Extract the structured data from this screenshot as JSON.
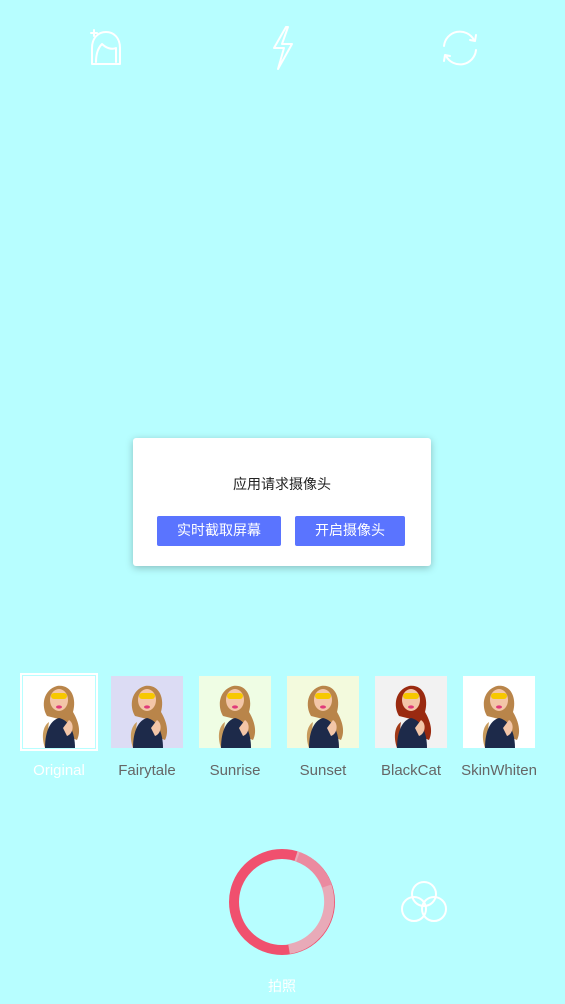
{
  "toolbar": {
    "beauty_icon": "beauty-face-icon",
    "flash_icon": "flash-icon",
    "switch_icon": "switch-camera-icon"
  },
  "dialog": {
    "message": "应用请求摄像头",
    "screen_capture_button": "实时截取屏幕",
    "open_camera_button": "开启摄像头"
  },
  "filters": [
    {
      "label": "Original",
      "selected": true,
      "tint": "#ffffff"
    },
    {
      "label": "Fairytale",
      "selected": false,
      "tint": "#dcdcf4"
    },
    {
      "label": "Sunrise",
      "selected": false,
      "tint": "#effde4"
    },
    {
      "label": "Sunset",
      "selected": false,
      "tint": "#f3fadd"
    },
    {
      "label": "BlackCat",
      "selected": false,
      "tint": "#f2f2f2"
    },
    {
      "label": "SkinWhiten",
      "selected": false,
      "tint": "#ffffff"
    }
  ],
  "shutter": {
    "label": "拍照"
  },
  "colors": {
    "background": "#b7feff",
    "accent": "#5a74ff",
    "shutter_red": "#f0506e",
    "shutter_pink": "#e8aab8"
  }
}
